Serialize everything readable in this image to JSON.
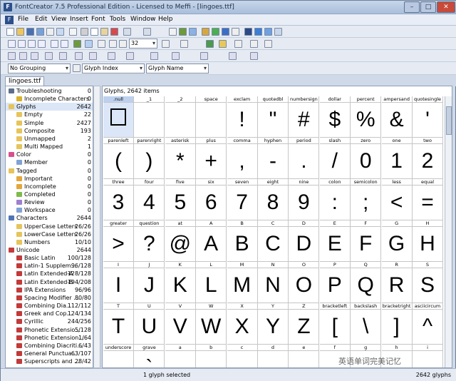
{
  "titlebar": {
    "title": "FontCreator 7.5 Professional Edition - Licensed to Meffi - [lingoes.ttf]",
    "icon": "F"
  },
  "menu": {
    "items": [
      "File",
      "Edit",
      "View",
      "Insert",
      "Font",
      "Tools",
      "Window",
      "Help"
    ]
  },
  "toolbar": {
    "zoom_value": "32",
    "grouping": "No Grouping",
    "index": "Glyph Index",
    "name": "Glyph Name"
  },
  "tab": {
    "label": "lingoes.ttf"
  },
  "tree": [
    {
      "label": "Troubleshooting",
      "count": "0",
      "indent": 0,
      "icon": "wrench-icon",
      "color": "#5c6f8a"
    },
    {
      "label": "Incomplete Characters",
      "count": "0",
      "indent": 1,
      "icon": "warning-icon",
      "color": "#d9b22b"
    },
    {
      "label": "Glyphs",
      "count": "2642",
      "indent": 0,
      "icon": "folder-icon",
      "color": "#e6c45a",
      "selected": true
    },
    {
      "label": "Empty",
      "count": "22",
      "indent": 1,
      "icon": "folder-icon",
      "color": "#e6c45a"
    },
    {
      "label": "Simple",
      "count": "2427",
      "indent": 1,
      "icon": "folder-icon",
      "color": "#e6c45a"
    },
    {
      "label": "Composite",
      "count": "193",
      "indent": 1,
      "icon": "folder-icon",
      "color": "#e6c45a"
    },
    {
      "label": "Unmapped",
      "count": "2",
      "indent": 1,
      "icon": "folder-icon",
      "color": "#e6c45a"
    },
    {
      "label": "Multi Mapped",
      "count": "1",
      "indent": 1,
      "icon": "folder-icon",
      "color": "#e6c45a"
    },
    {
      "label": "Color",
      "count": "0",
      "indent": 0,
      "icon": "palette-icon",
      "color": "#d84f8f"
    },
    {
      "label": "Member",
      "count": "0",
      "indent": 1,
      "icon": "palette-icon",
      "color": "#7fa3d6"
    },
    {
      "label": "Tagged",
      "count": "0",
      "indent": 0,
      "icon": "folder-icon",
      "color": "#e6c45a"
    },
    {
      "label": "Important",
      "count": "0",
      "indent": 1,
      "icon": "tag-icon",
      "color": "#e2a63b"
    },
    {
      "label": "Incomplete",
      "count": "0",
      "indent": 1,
      "icon": "tag-icon",
      "color": "#e2a63b"
    },
    {
      "label": "Completed",
      "count": "0",
      "indent": 1,
      "icon": "tag-icon",
      "color": "#7dbb4d"
    },
    {
      "label": "Review",
      "count": "0",
      "indent": 1,
      "icon": "tag-icon",
      "color": "#9f7fcf"
    },
    {
      "label": "Workspace",
      "count": "0",
      "indent": 1,
      "icon": "tag-icon",
      "color": "#7fa3d6"
    },
    {
      "label": "Characters",
      "count": "2644",
      "indent": 0,
      "icon": "char-icon",
      "color": "#4d74b8"
    },
    {
      "label": "UpperCase Letters",
      "count": "26/26",
      "indent": 1,
      "icon": "folder-icon",
      "color": "#e6c45a"
    },
    {
      "label": "LowerCase Letters",
      "count": "26/26",
      "indent": 1,
      "icon": "folder-icon",
      "color": "#e6c45a"
    },
    {
      "label": "Numbers",
      "count": "10/10",
      "indent": 1,
      "icon": "folder-icon",
      "color": "#e6c45a"
    },
    {
      "label": "Unicode",
      "count": "2644",
      "indent": 0,
      "icon": "unicode-icon",
      "color": "#c23a3a"
    },
    {
      "label": "Basic Latin",
      "count": "100/128",
      "indent": 1,
      "icon": "unicode-icon",
      "color": "#c23a3a"
    },
    {
      "label": "Latin-1 Supplem...",
      "count": "96/128",
      "indent": 1,
      "icon": "unicode-icon",
      "color": "#c23a3a"
    },
    {
      "label": "Latin Extended-A",
      "count": "128/128",
      "indent": 1,
      "icon": "unicode-icon",
      "color": "#c23a3a"
    },
    {
      "label": "Latin Extended-B",
      "count": "194/208",
      "indent": 1,
      "icon": "unicode-icon",
      "color": "#c23a3a"
    },
    {
      "label": "IPA Extensions",
      "count": "96/96",
      "indent": 1,
      "icon": "unicode-icon",
      "color": "#c23a3a"
    },
    {
      "label": "Spacing Modifier ...",
      "count": "80/80",
      "indent": 1,
      "icon": "unicode-icon",
      "color": "#c23a3a"
    },
    {
      "label": "Combining Dia...",
      "count": "112/112",
      "indent": 1,
      "icon": "unicode-icon",
      "color": "#c23a3a"
    },
    {
      "label": "Greek and Cop...",
      "count": "124/134",
      "indent": 1,
      "icon": "unicode-icon",
      "color": "#c23a3a"
    },
    {
      "label": "Cyrillic",
      "count": "244/256",
      "indent": 1,
      "icon": "unicode-icon",
      "color": "#c23a3a"
    },
    {
      "label": "Phonetic Extensio...",
      "count": "5/128",
      "indent": 1,
      "icon": "unicode-icon",
      "color": "#c23a3a"
    },
    {
      "label": "Phonetic Extension...",
      "count": "1/64",
      "indent": 1,
      "icon": "unicode-icon",
      "color": "#c23a3a"
    },
    {
      "label": "Combining Diacriti...",
      "count": "6/43",
      "indent": 1,
      "icon": "unicode-icon",
      "color": "#c23a3a"
    },
    {
      "label": "General Punctua...",
      "count": "63/107",
      "indent": 1,
      "icon": "unicode-icon",
      "color": "#c23a3a"
    },
    {
      "label": "Superscripts and ...",
      "count": "28/42",
      "indent": 1,
      "icon": "unicode-icon",
      "color": "#c23a3a"
    }
  ],
  "main": {
    "header": "Glyphs, 2642 items"
  },
  "glyphs": [
    {
      "name": ".null",
      "char": "",
      "selected": true
    },
    {
      "name": "_1",
      "char": ""
    },
    {
      "name": "_2",
      "char": ""
    },
    {
      "name": "space",
      "char": ""
    },
    {
      "name": "exclam",
      "char": "!"
    },
    {
      "name": "quotedbl",
      "char": "\""
    },
    {
      "name": "numbersign",
      "char": "#"
    },
    {
      "name": "dollar",
      "char": "$"
    },
    {
      "name": "percent",
      "char": "%"
    },
    {
      "name": "ampersand",
      "char": "&"
    },
    {
      "name": "quotesingle",
      "char": "'"
    },
    {
      "name": "parenleft",
      "char": "("
    },
    {
      "name": "parenright",
      "char": ")"
    },
    {
      "name": "asterisk",
      "char": "*"
    },
    {
      "name": "plus",
      "char": "+"
    },
    {
      "name": "comma",
      "char": ","
    },
    {
      "name": "hyphen",
      "char": "-"
    },
    {
      "name": "period",
      "char": "."
    },
    {
      "name": "slash",
      "char": "/"
    },
    {
      "name": "zero",
      "char": "0"
    },
    {
      "name": "one",
      "char": "1"
    },
    {
      "name": "two",
      "char": "2"
    },
    {
      "name": "three",
      "char": "3"
    },
    {
      "name": "four",
      "char": "4"
    },
    {
      "name": "five",
      "char": "5"
    },
    {
      "name": "six",
      "char": "6"
    },
    {
      "name": "seven",
      "char": "7"
    },
    {
      "name": "eight",
      "char": "8"
    },
    {
      "name": "nine",
      "char": "9"
    },
    {
      "name": "colon",
      "char": ":"
    },
    {
      "name": "semicolon",
      "char": ";"
    },
    {
      "name": "less",
      "char": "<"
    },
    {
      "name": "equal",
      "char": "="
    },
    {
      "name": "greater",
      "char": ">"
    },
    {
      "name": "question",
      "char": "?"
    },
    {
      "name": "at",
      "char": "@"
    },
    {
      "name": "A",
      "char": "A"
    },
    {
      "name": "B",
      "char": "B"
    },
    {
      "name": "C",
      "char": "C"
    },
    {
      "name": "D",
      "char": "D"
    },
    {
      "name": "E",
      "char": "E"
    },
    {
      "name": "F",
      "char": "F"
    },
    {
      "name": "G",
      "char": "G"
    },
    {
      "name": "H",
      "char": "H"
    },
    {
      "name": "I",
      "char": "I"
    },
    {
      "name": "J",
      "char": "J"
    },
    {
      "name": "K",
      "char": "K"
    },
    {
      "name": "L",
      "char": "L"
    },
    {
      "name": "M",
      "char": "M"
    },
    {
      "name": "N",
      "char": "N"
    },
    {
      "name": "O",
      "char": "O"
    },
    {
      "name": "P",
      "char": "P"
    },
    {
      "name": "Q",
      "char": "Q"
    },
    {
      "name": "R",
      "char": "R"
    },
    {
      "name": "S",
      "char": "S"
    },
    {
      "name": "T",
      "char": "T"
    },
    {
      "name": "U",
      "char": "U"
    },
    {
      "name": "V",
      "char": "V"
    },
    {
      "name": "W",
      "char": "W"
    },
    {
      "name": "X",
      "char": "X"
    },
    {
      "name": "Y",
      "char": "Y"
    },
    {
      "name": "Z",
      "char": "Z"
    },
    {
      "name": "bracketleft",
      "char": "["
    },
    {
      "name": "backslash",
      "char": "\\"
    },
    {
      "name": "bracketright",
      "char": "]"
    },
    {
      "name": "asciicircum",
      "char": "^"
    },
    {
      "name": "underscore",
      "char": ""
    },
    {
      "name": "grave",
      "char": "`"
    },
    {
      "name": "a",
      "char": ""
    },
    {
      "name": "b",
      "char": ""
    },
    {
      "name": "c",
      "char": ""
    },
    {
      "name": "d",
      "char": ""
    },
    {
      "name": "e",
      "char": ""
    },
    {
      "name": "f",
      "char": ""
    },
    {
      "name": "g",
      "char": ""
    },
    {
      "name": "h",
      "char": ""
    },
    {
      "name": "i",
      "char": ""
    }
  ],
  "status": {
    "selection": "1 glyph selected",
    "count": "2642 glyphs"
  },
  "watermark": "英语单词完美记忆"
}
